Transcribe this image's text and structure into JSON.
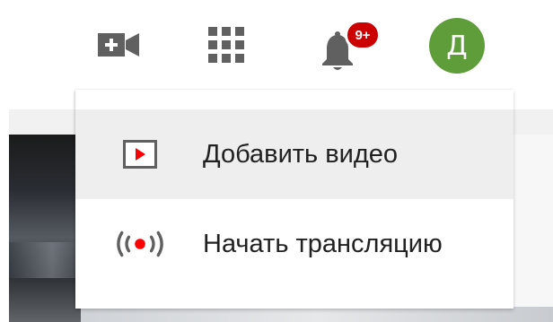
{
  "header": {
    "create_icon": "video-camera-plus-icon",
    "apps_icon": "apps-grid-icon",
    "notifications_icon": "bell-icon",
    "notifications_badge": "9+",
    "avatar_letter": "Д"
  },
  "create_menu": {
    "items": [
      {
        "label": "Добавить видео",
        "icon": "upload-video-icon"
      },
      {
        "label": "Начать трансляцию",
        "icon": "live-broadcast-icon"
      }
    ]
  },
  "colors": {
    "brand_red": "#ff0000",
    "badge_red": "#cc0000",
    "avatar_green": "#5f9d3a",
    "icon_gray": "#606060",
    "menu_hover": "#eeeeee"
  }
}
